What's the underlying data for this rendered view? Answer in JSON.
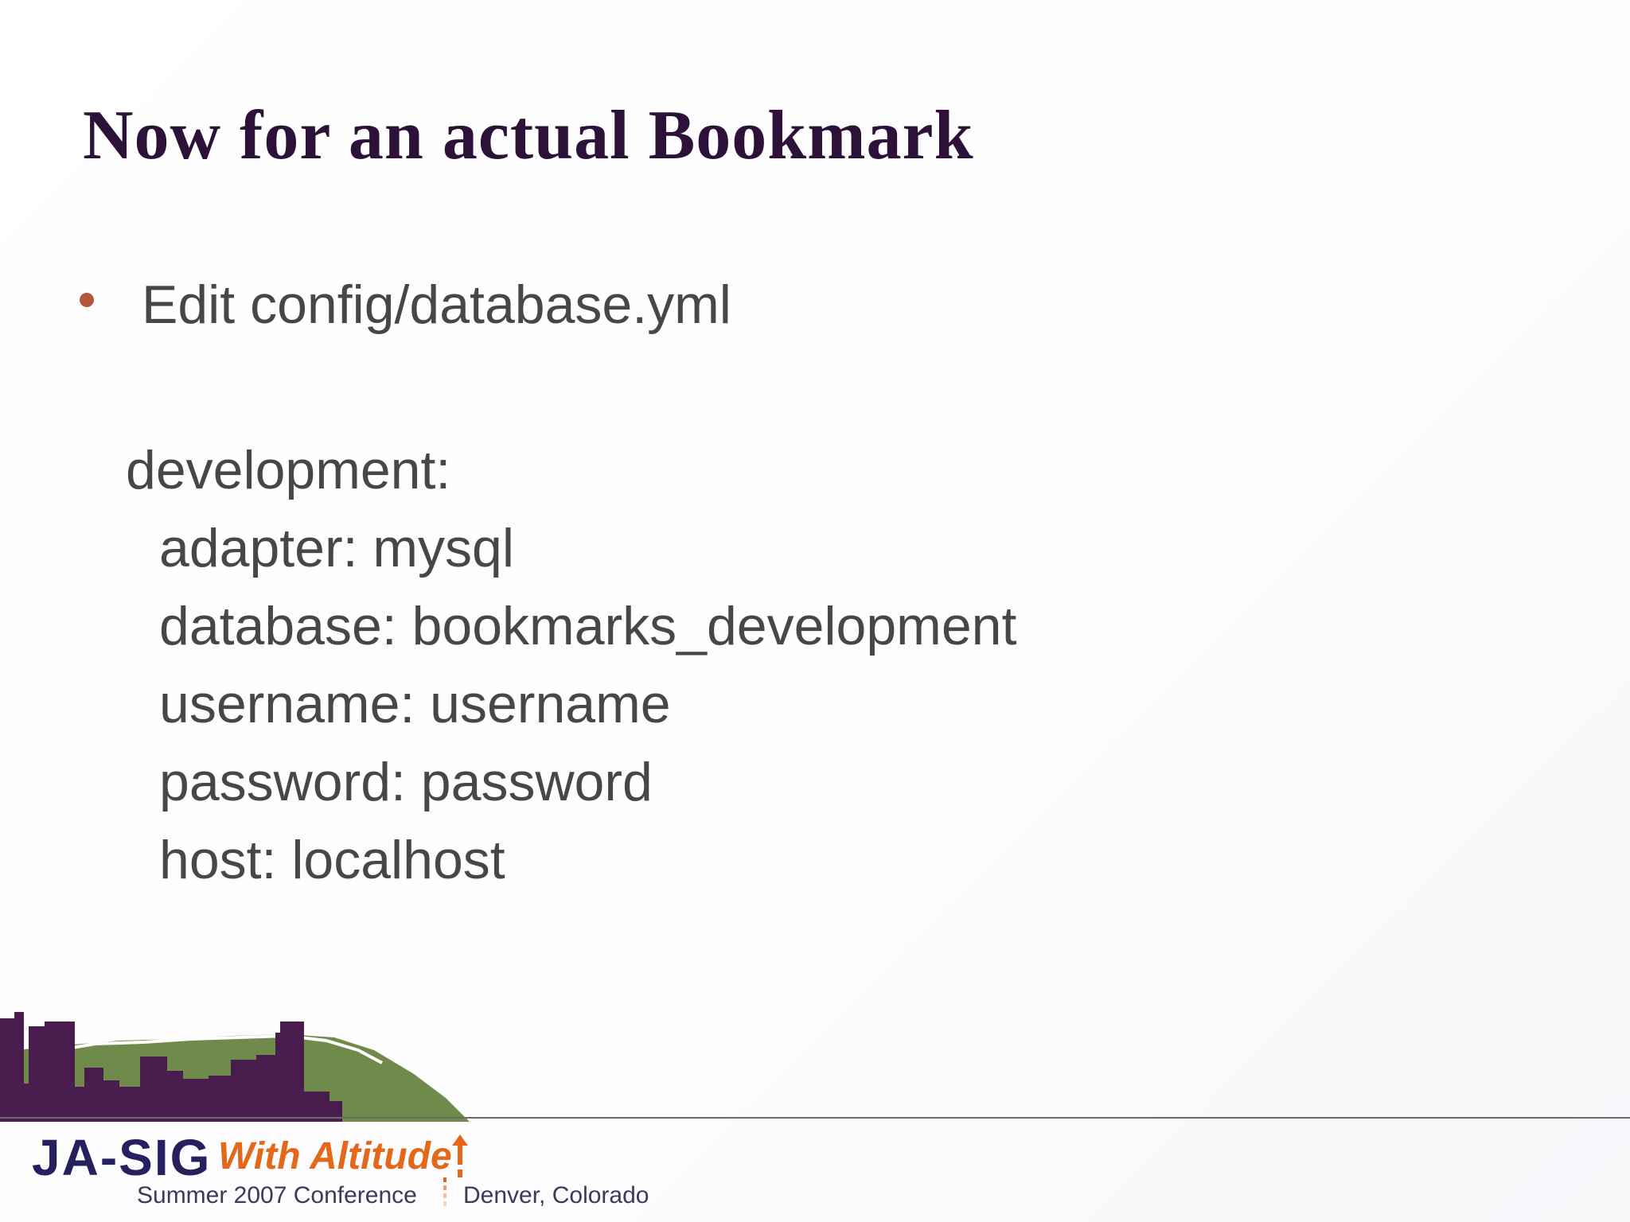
{
  "slide": {
    "title": "Now for an actual Bookmark",
    "bullet": "Edit config/database.yml",
    "code": {
      "env": "development:",
      "lines": [
        "adapter: mysql",
        "database: bookmarks_development",
        "username: username",
        "password: password",
        "host: localhost"
      ]
    }
  },
  "footer": {
    "logo_text": "JA-SIG",
    "tagline": "With Altitude",
    "conference": "Summer 2007 Conference",
    "location": "Denver, Colorado"
  },
  "colors": {
    "title": "#2c1238",
    "bullet_dot": "#b5553a",
    "body_text": "#474747",
    "skyline_purple": "#4a1d4f",
    "mountain_green": "#6f8a4a",
    "logo_navy": "#25205e",
    "tagline_orange": "#e4671a"
  },
  "icons": {
    "bullet": "bullet-dot",
    "skyline": "denver-skyline-graphic",
    "tagline_arrow": "up-arrow-icon"
  }
}
